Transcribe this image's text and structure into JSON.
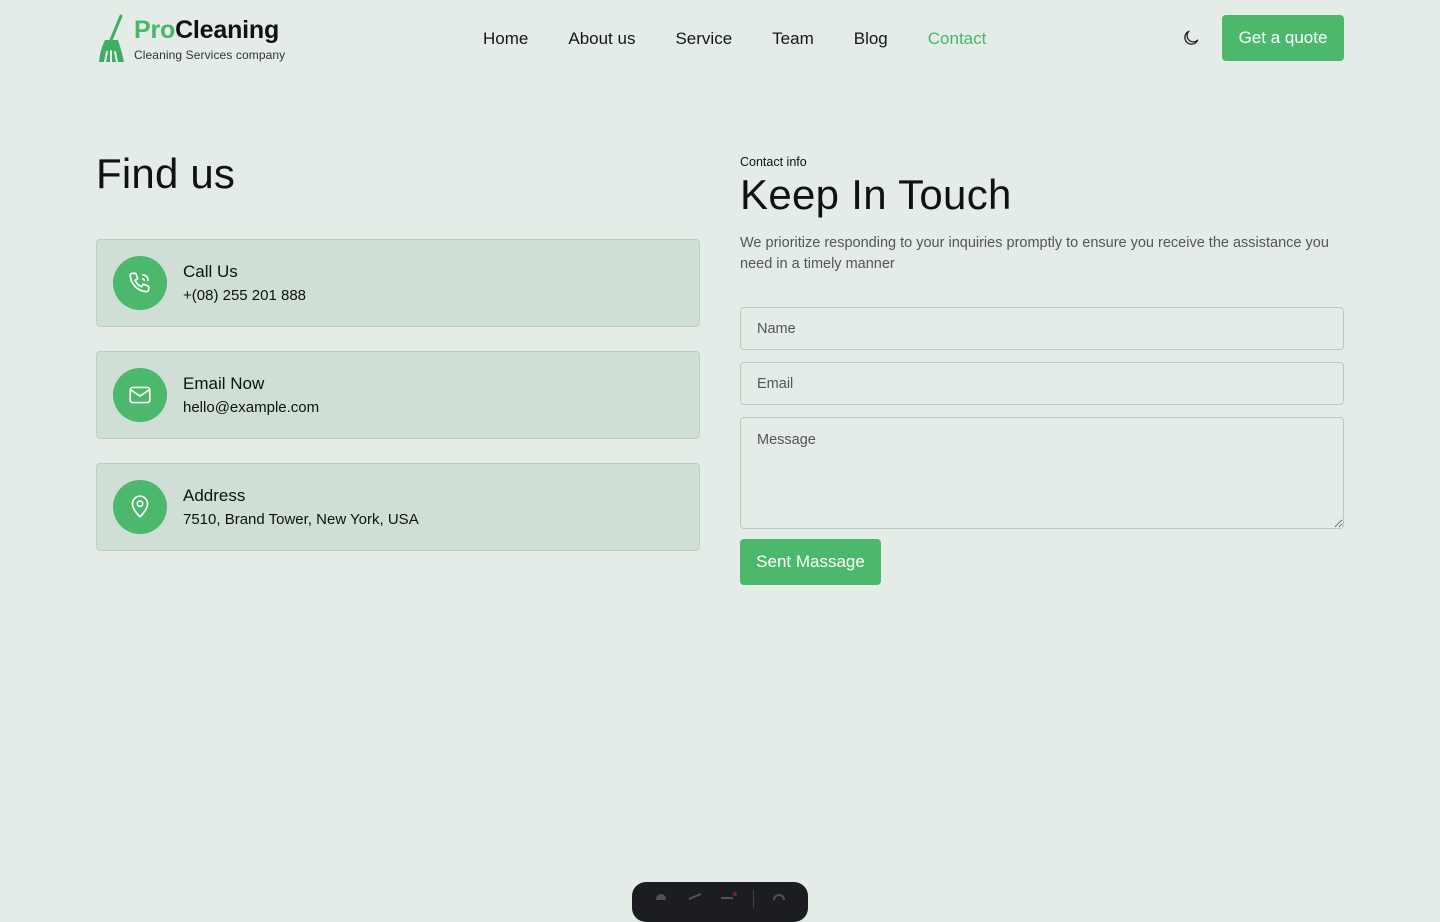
{
  "header": {
    "brand_pro": "Pro",
    "brand_rest": "Cleaning",
    "tagline": "Cleaning Services company",
    "nav": [
      {
        "label": "Home",
        "active": false
      },
      {
        "label": "About us",
        "active": false
      },
      {
        "label": "Service",
        "active": false
      },
      {
        "label": "Team",
        "active": false
      },
      {
        "label": "Blog",
        "active": false
      },
      {
        "label": "Contact",
        "active": true
      }
    ],
    "theme_icon": "moon-icon",
    "quote_label": "Get a quote"
  },
  "find": {
    "title": "Find us",
    "cards": [
      {
        "icon": "phone-icon",
        "title": "Call Us",
        "value": "+(08) 255 201 888"
      },
      {
        "icon": "mail-icon",
        "title": "Email Now",
        "value": "hello@example.com"
      },
      {
        "icon": "location-pin-icon",
        "title": "Address",
        "value": "7510, Brand Tower, New York, USA"
      }
    ]
  },
  "contact": {
    "eyebrow": "Contact info",
    "title": "Keep In Touch",
    "description": "We prioritize responding to your inquiries promptly to ensure you receive the assistance you need in a timely manner",
    "name_placeholder": "Name",
    "email_placeholder": "Email",
    "message_placeholder": "Message",
    "submit_label": "Sent Massage"
  },
  "colors": {
    "accent": "#4cb86c",
    "background": "#e3ece7",
    "card": "#cfdfd5"
  }
}
